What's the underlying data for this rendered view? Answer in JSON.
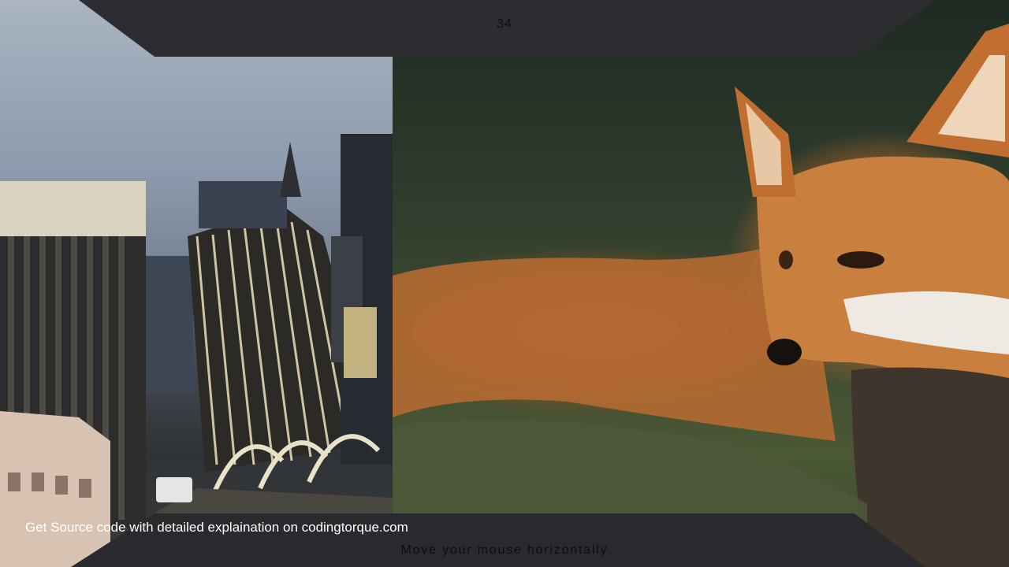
{
  "gallery": {
    "page_number": "34",
    "footer_credit": "Get Source code with detailed explaination on codingtorque.com",
    "instruction": "Move your mouse horizontally"
  },
  "colors": {
    "room_background": "#2b2a30",
    "credit_text": "#ffffff",
    "hint_text": "#0d0d0f"
  },
  "walls": [
    {
      "name": "left-wall",
      "subject": "city skyline"
    },
    {
      "name": "right-wall",
      "subject": "red fox"
    }
  ]
}
